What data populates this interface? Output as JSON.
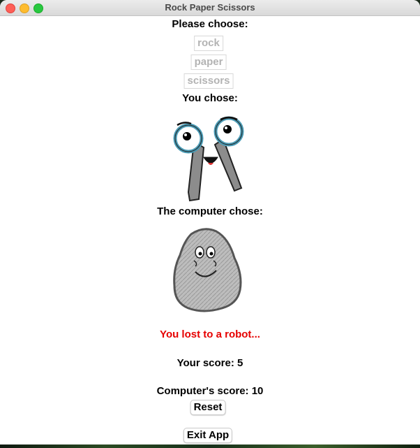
{
  "window": {
    "title": "Rock Paper Scissors"
  },
  "prompt": {
    "label": "Please choose:",
    "options": [
      "rock",
      "paper",
      "scissors"
    ]
  },
  "player": {
    "label": "You chose:",
    "choice_icon": "scissors-icon"
  },
  "computer": {
    "label": "The computer chose:",
    "choice_icon": "rock-icon"
  },
  "result": {
    "message": "You lost to a robot...",
    "color": "#e60000"
  },
  "scores": {
    "your_score": "Your score: 5",
    "computer_score": "Computer's score: 10"
  },
  "buttons": {
    "reset": "Reset",
    "exit": "Exit App"
  }
}
